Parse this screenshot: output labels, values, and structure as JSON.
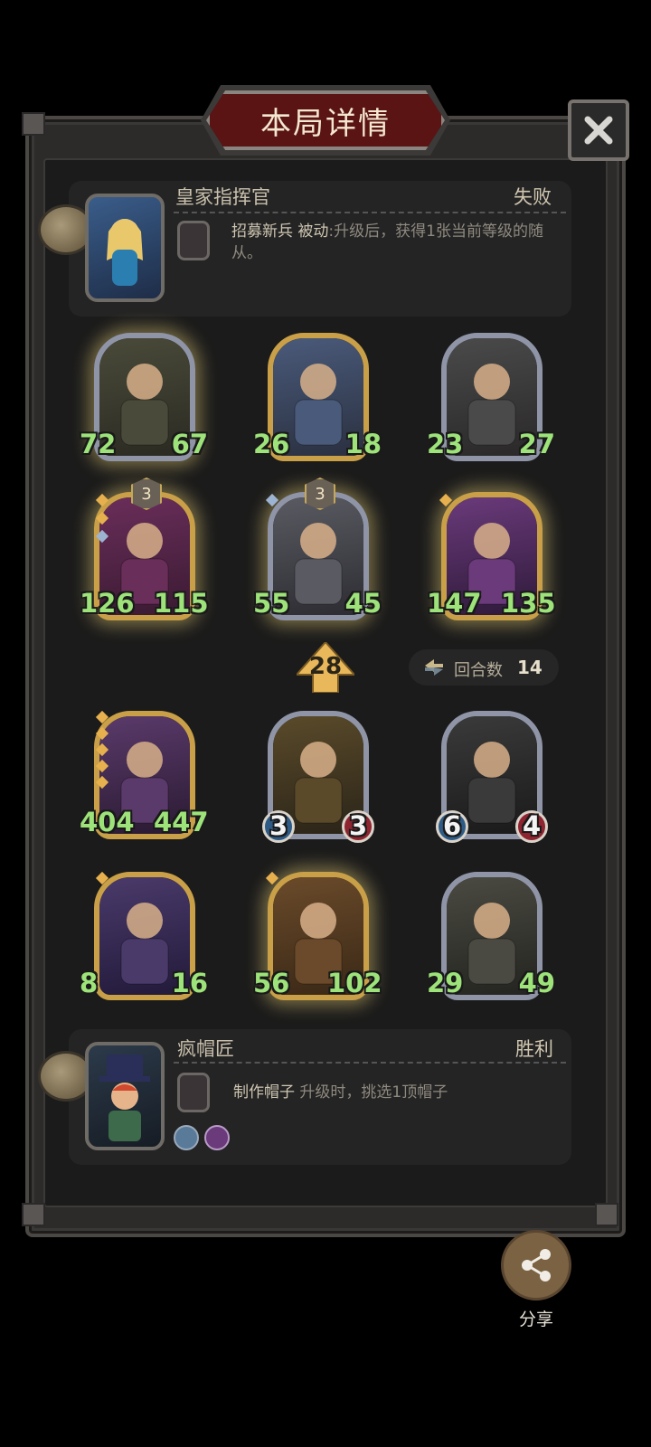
{
  "header": {
    "title": "本局详情"
  },
  "top_player": {
    "name": "皇家指挥官",
    "result": "失败",
    "ability_name": "招募新兵",
    "ability_tag": "被动",
    "ability_text": ":升级后，获得1张当前等级的随从。"
  },
  "top_cards": [
    {
      "name": "bandit",
      "attack": "72",
      "health": "67",
      "frame": "silver",
      "glow": true
    },
    {
      "name": "warrior",
      "attack": "26",
      "health": "18",
      "frame": "gold",
      "glow": false
    },
    {
      "name": "blacksmith",
      "attack": "23",
      "health": "27",
      "frame": "silver",
      "glow": false
    },
    {
      "name": "clown",
      "attack": "126",
      "health": "115",
      "frame": "gold",
      "glow": true,
      "level": "3"
    },
    {
      "name": "knight-shield",
      "attack": "55",
      "health": "45",
      "frame": "silver",
      "glow": true,
      "level": "3"
    },
    {
      "name": "valkyrie",
      "attack": "147",
      "health": "135",
      "frame": "gold",
      "glow": true
    }
  ],
  "tier": {
    "value": "28"
  },
  "turns": {
    "label": "回合数",
    "value": "14"
  },
  "bottom_cards": [
    {
      "name": "rock-golem",
      "attack": "404",
      "health": "447",
      "frame": "gold",
      "glow": false
    },
    {
      "name": "golden-king",
      "attack": "3",
      "health": "3",
      "frame": "silver",
      "glow": false
    },
    {
      "name": "spade-knight",
      "attack": "6",
      "health": "4",
      "frame": "silver",
      "glow": false
    },
    {
      "name": "snow-bride",
      "attack": "8",
      "health": "16",
      "frame": "gold",
      "glow": false
    },
    {
      "name": "treant",
      "attack": "56",
      "health": "102",
      "frame": "gold",
      "glow": true
    },
    {
      "name": "detective",
      "attack": "29",
      "health": "49",
      "frame": "silver",
      "glow": false
    }
  ],
  "bottom_player": {
    "name": "疯帽匠",
    "result": "胜利",
    "ability_name": "制作帽子",
    "ability_text": "升级时，挑选1顶帽子"
  },
  "share": {
    "label": "分享"
  },
  "colors": {
    "stat_green": "#9de37a",
    "title_red": "#5a1414",
    "gold_frame": "#c9a048",
    "silver_frame": "#8f95a6"
  }
}
